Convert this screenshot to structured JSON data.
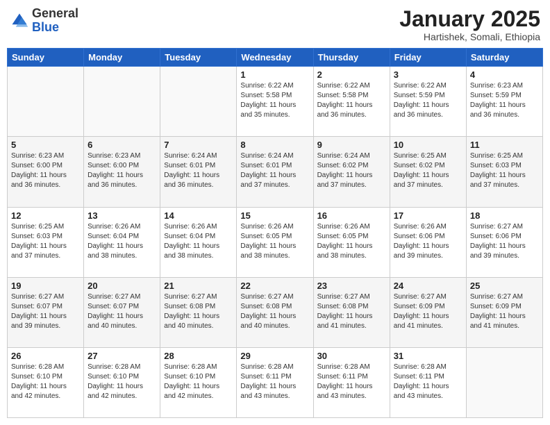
{
  "header": {
    "logo_general": "General",
    "logo_blue": "Blue",
    "month_title": "January 2025",
    "subtitle": "Hartishek, Somali, Ethiopia"
  },
  "days_of_week": [
    "Sunday",
    "Monday",
    "Tuesday",
    "Wednesday",
    "Thursday",
    "Friday",
    "Saturday"
  ],
  "weeks": [
    [
      {
        "day": "",
        "info": ""
      },
      {
        "day": "",
        "info": ""
      },
      {
        "day": "",
        "info": ""
      },
      {
        "day": "1",
        "info": "Sunrise: 6:22 AM\nSunset: 5:58 PM\nDaylight: 11 hours and 35 minutes."
      },
      {
        "day": "2",
        "info": "Sunrise: 6:22 AM\nSunset: 5:58 PM\nDaylight: 11 hours and 36 minutes."
      },
      {
        "day": "3",
        "info": "Sunrise: 6:22 AM\nSunset: 5:59 PM\nDaylight: 11 hours and 36 minutes."
      },
      {
        "day": "4",
        "info": "Sunrise: 6:23 AM\nSunset: 5:59 PM\nDaylight: 11 hours and 36 minutes."
      }
    ],
    [
      {
        "day": "5",
        "info": "Sunrise: 6:23 AM\nSunset: 6:00 PM\nDaylight: 11 hours and 36 minutes."
      },
      {
        "day": "6",
        "info": "Sunrise: 6:23 AM\nSunset: 6:00 PM\nDaylight: 11 hours and 36 minutes."
      },
      {
        "day": "7",
        "info": "Sunrise: 6:24 AM\nSunset: 6:01 PM\nDaylight: 11 hours and 36 minutes."
      },
      {
        "day": "8",
        "info": "Sunrise: 6:24 AM\nSunset: 6:01 PM\nDaylight: 11 hours and 37 minutes."
      },
      {
        "day": "9",
        "info": "Sunrise: 6:24 AM\nSunset: 6:02 PM\nDaylight: 11 hours and 37 minutes."
      },
      {
        "day": "10",
        "info": "Sunrise: 6:25 AM\nSunset: 6:02 PM\nDaylight: 11 hours and 37 minutes."
      },
      {
        "day": "11",
        "info": "Sunrise: 6:25 AM\nSunset: 6:03 PM\nDaylight: 11 hours and 37 minutes."
      }
    ],
    [
      {
        "day": "12",
        "info": "Sunrise: 6:25 AM\nSunset: 6:03 PM\nDaylight: 11 hours and 37 minutes."
      },
      {
        "day": "13",
        "info": "Sunrise: 6:26 AM\nSunset: 6:04 PM\nDaylight: 11 hours and 38 minutes."
      },
      {
        "day": "14",
        "info": "Sunrise: 6:26 AM\nSunset: 6:04 PM\nDaylight: 11 hours and 38 minutes."
      },
      {
        "day": "15",
        "info": "Sunrise: 6:26 AM\nSunset: 6:05 PM\nDaylight: 11 hours and 38 minutes."
      },
      {
        "day": "16",
        "info": "Sunrise: 6:26 AM\nSunset: 6:05 PM\nDaylight: 11 hours and 38 minutes."
      },
      {
        "day": "17",
        "info": "Sunrise: 6:26 AM\nSunset: 6:06 PM\nDaylight: 11 hours and 39 minutes."
      },
      {
        "day": "18",
        "info": "Sunrise: 6:27 AM\nSunset: 6:06 PM\nDaylight: 11 hours and 39 minutes."
      }
    ],
    [
      {
        "day": "19",
        "info": "Sunrise: 6:27 AM\nSunset: 6:07 PM\nDaylight: 11 hours and 39 minutes."
      },
      {
        "day": "20",
        "info": "Sunrise: 6:27 AM\nSunset: 6:07 PM\nDaylight: 11 hours and 40 minutes."
      },
      {
        "day": "21",
        "info": "Sunrise: 6:27 AM\nSunset: 6:08 PM\nDaylight: 11 hours and 40 minutes."
      },
      {
        "day": "22",
        "info": "Sunrise: 6:27 AM\nSunset: 6:08 PM\nDaylight: 11 hours and 40 minutes."
      },
      {
        "day": "23",
        "info": "Sunrise: 6:27 AM\nSunset: 6:08 PM\nDaylight: 11 hours and 41 minutes."
      },
      {
        "day": "24",
        "info": "Sunrise: 6:27 AM\nSunset: 6:09 PM\nDaylight: 11 hours and 41 minutes."
      },
      {
        "day": "25",
        "info": "Sunrise: 6:27 AM\nSunset: 6:09 PM\nDaylight: 11 hours and 41 minutes."
      }
    ],
    [
      {
        "day": "26",
        "info": "Sunrise: 6:28 AM\nSunset: 6:10 PM\nDaylight: 11 hours and 42 minutes."
      },
      {
        "day": "27",
        "info": "Sunrise: 6:28 AM\nSunset: 6:10 PM\nDaylight: 11 hours and 42 minutes."
      },
      {
        "day": "28",
        "info": "Sunrise: 6:28 AM\nSunset: 6:10 PM\nDaylight: 11 hours and 42 minutes."
      },
      {
        "day": "29",
        "info": "Sunrise: 6:28 AM\nSunset: 6:11 PM\nDaylight: 11 hours and 43 minutes."
      },
      {
        "day": "30",
        "info": "Sunrise: 6:28 AM\nSunset: 6:11 PM\nDaylight: 11 hours and 43 minutes."
      },
      {
        "day": "31",
        "info": "Sunrise: 6:28 AM\nSunset: 6:11 PM\nDaylight: 11 hours and 43 minutes."
      },
      {
        "day": "",
        "info": ""
      }
    ]
  ],
  "colors": {
    "header_bg": "#2060c0",
    "header_text": "#ffffff",
    "row_even_bg": "#f5f5f5",
    "row_odd_bg": "#ffffff"
  }
}
